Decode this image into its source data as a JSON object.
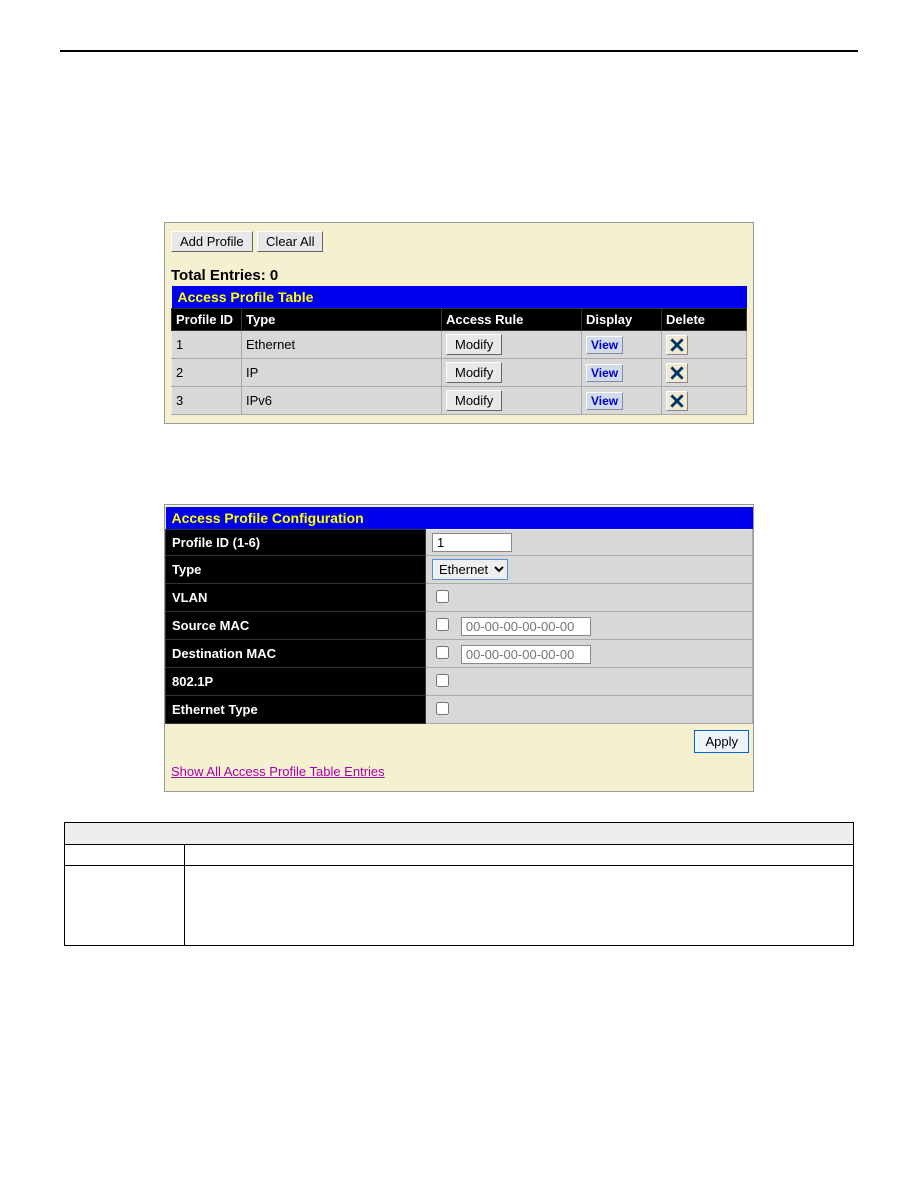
{
  "buttons": {
    "add_profile": "Add Profile",
    "clear_all": "Clear All",
    "modify": "Modify",
    "view": "View",
    "apply": "Apply"
  },
  "profile_table": {
    "total_label": "Total Entries: 0",
    "title": "Access Profile Table",
    "headers": {
      "profile_id": "Profile ID",
      "type": "Type",
      "access_rule": "Access Rule",
      "display": "Display",
      "delete": "Delete"
    },
    "rows": [
      {
        "id": "1",
        "type": "Ethernet"
      },
      {
        "id": "2",
        "type": "IP"
      },
      {
        "id": "3",
        "type": "IPv6"
      }
    ]
  },
  "config": {
    "title": "Access Profile Configuration",
    "labels": {
      "profile_id": "Profile ID (1-6)",
      "type": "Type",
      "vlan": "VLAN",
      "src_mac": "Source MAC",
      "dst_mac": "Destination MAC",
      "p8021": "802.1P",
      "eth_type": "Ethernet Type"
    },
    "values": {
      "profile_id": "1",
      "type_selected": "Ethernet",
      "src_mac_placeholder": "00-00-00-00-00-00",
      "dst_mac_placeholder": "00-00-00-00-00-00"
    },
    "show_all_link": "Show All Access Profile Table Entries"
  },
  "param_table": {
    "header": "",
    "col1": "",
    "col2": ""
  }
}
